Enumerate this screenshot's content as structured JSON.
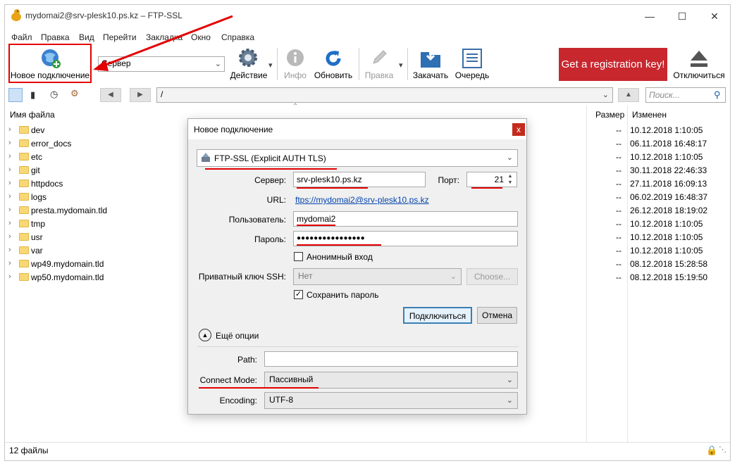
{
  "window": {
    "title": "mydomai2@srv-plesk10.ps.kz – FTP-SSL"
  },
  "menu": [
    "Файл",
    "Правка",
    "Вид",
    "Перейти",
    "Закладка",
    "Окно",
    "Справка"
  ],
  "toolbar": {
    "new_connection": "Новое подключение",
    "server_select": "Сервер",
    "action": "Действие",
    "info": "Инфо",
    "refresh": "Обновить",
    "edit": "Правка",
    "download": "Закачать",
    "queue": "Очередь",
    "registration": "Get a registration key!",
    "disconnect": "Отключиться"
  },
  "nav": {
    "path": "/",
    "search_placeholder": "Поиск..."
  },
  "filelist": {
    "col_name": "Имя файла",
    "col_size": "Размер",
    "col_modified": "Изменен",
    "rows": [
      {
        "name": "dev",
        "size": "--",
        "modified": "10.12.2018 1:10:05"
      },
      {
        "name": "error_docs",
        "size": "--",
        "modified": "06.11.2018 16:48:17"
      },
      {
        "name": "etc",
        "size": "--",
        "modified": "10.12.2018 1:10:05"
      },
      {
        "name": "git",
        "size": "--",
        "modified": "30.11.2018 22:46:33"
      },
      {
        "name": "httpdocs",
        "size": "--",
        "modified": "27.11.2018 16:09:13"
      },
      {
        "name": "logs",
        "size": "--",
        "modified": "06.02.2019 16:48:37"
      },
      {
        "name": "presta.mydomain.tld",
        "size": "--",
        "modified": "26.12.2018 18:19:02"
      },
      {
        "name": "tmp",
        "size": "--",
        "modified": "10.12.2018 1:10:05"
      },
      {
        "name": "usr",
        "size": "--",
        "modified": "10.12.2018 1:10:05"
      },
      {
        "name": "var",
        "size": "--",
        "modified": "10.12.2018 1:10:05"
      },
      {
        "name": "wp49.mydomain.tld",
        "size": "--",
        "modified": "08.12.2018 15:28:58"
      },
      {
        "name": "wp50.mydomain.tld",
        "size": "--",
        "modified": "08.12.2018 15:19:50"
      }
    ]
  },
  "status": {
    "text": "12 файлы"
  },
  "dialog": {
    "title": "Новое подключение",
    "close": "x",
    "protocol": "FTP-SSL (Explicit AUTH TLS)",
    "server_label": "Сервер:",
    "server_value": "srv-plesk10.ps.kz",
    "port_label": "Порт:",
    "port_value": "21",
    "url_label": "URL:",
    "url_value": "ftps://mydomai2@srv-plesk10.ps.kz",
    "user_label": "Пользователь:",
    "user_value": "mydomai2",
    "password_label": "Пароль:",
    "password_value": "●●●●●●●●●●●●●●●●",
    "anonymous_label": "Анонимный вход",
    "anonymous_checked": false,
    "ssh_key_label": "Приватный ключ SSH:",
    "ssh_key_value": "Нет",
    "choose_button": "Choose...",
    "save_password_label": "Сохранить пароль",
    "save_password_checked": true,
    "connect_button": "Подключиться",
    "cancel_button": "Отмена",
    "more_options": "Ещё опции",
    "path_label": "Path:",
    "path_value": "",
    "connect_mode_label": "Connect Mode:",
    "connect_mode_value": "Пассивный",
    "encoding_label": "Encoding:",
    "encoding_value": "UTF-8"
  },
  "colors": {
    "accent_red": "#e30000",
    "registration_bg": "#c8272e",
    "link": "#0645ad"
  }
}
